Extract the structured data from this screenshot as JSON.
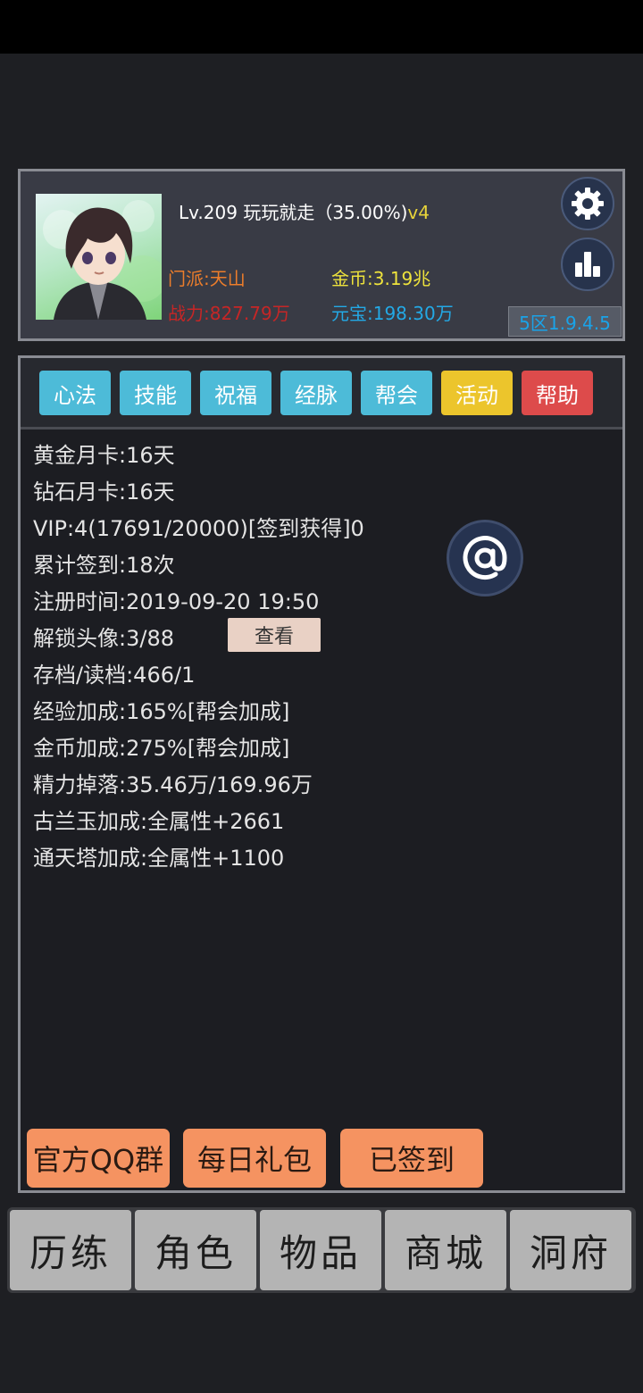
{
  "profile": {
    "level_line": "Lv.209 玩玩就走（35.00%)",
    "vip_tag": "v4",
    "sect": "门派:天山",
    "gold": "金币:3.19兆",
    "power": "战力:827.79万",
    "ingot": "元宝:198.30万",
    "server": "5区1.9.4.5",
    "settings_icon": "gear-icon",
    "ranking_icon": "bar-chart-icon"
  },
  "tabs": [
    {
      "label": "心法",
      "color": "#4dbbd8"
    },
    {
      "label": "技能",
      "color": "#4dbbd8"
    },
    {
      "label": "祝福",
      "color": "#4dbbd8"
    },
    {
      "label": "经脉",
      "color": "#4dbbd8"
    },
    {
      "label": "帮会",
      "color": "#4dbbd8"
    },
    {
      "label": "活动",
      "color": "#ecc52c"
    },
    {
      "label": "帮助",
      "color": "#dd4b4b"
    }
  ],
  "info_lines": [
    "黄金月卡:16天",
    "钻石月卡:16天",
    "VIP:4(17691/20000)[签到获得]0",
    "累计签到:18次",
    "注册时间:2019-09-20 19:50",
    "解锁头像:3/88",
    "存档/读档:466/1",
    "经验加成:165%[帮会加成]",
    "金币加成:275%[帮会加成]",
    "精力掉落:35.46万/169.96万",
    "古兰玉加成:全属性+2661",
    "通天塔加成:全属性+1100"
  ],
  "view_button": "查看",
  "mail_icon": "at-mail-icon",
  "actions": {
    "qq_group": "官方QQ群",
    "daily_gift": "每日礼包",
    "signed_in": "已签到"
  },
  "bottom_nav": [
    "历练",
    "角色",
    "物品",
    "商城",
    "洞府"
  ]
}
